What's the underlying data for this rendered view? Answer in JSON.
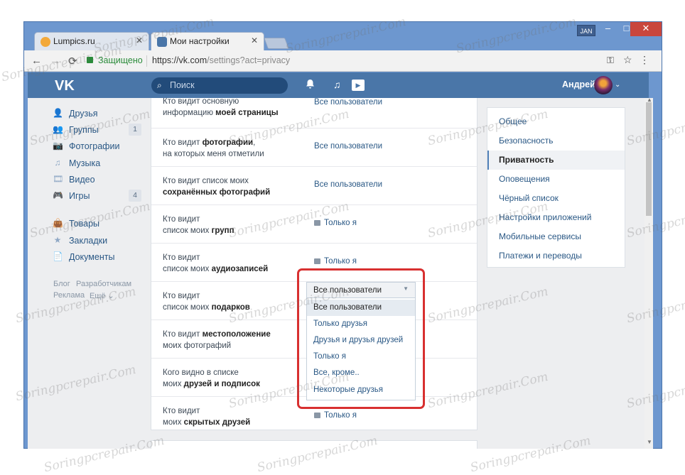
{
  "browser": {
    "tabs": [
      {
        "label": "Lumpics.ru",
        "favicon_color": "#f3a93a"
      },
      {
        "label": "Мои настройки",
        "favicon_color": "#4a76a8"
      }
    ],
    "profile_badge": "JAN",
    "window_controls": {
      "minimize": "–",
      "maximize": "□",
      "close": "✕"
    },
    "nav": {
      "back": "←",
      "forward": "→",
      "reload": "⟳"
    },
    "secure_label": "Защищено",
    "url_main": "https://vk.com",
    "url_rest": "/settings?act=privacy",
    "icons": {
      "key": "⚿",
      "star": "☆",
      "menu": "⋮"
    }
  },
  "header": {
    "logo": "VK",
    "search_placeholder": "Поиск",
    "user_name": "Андрей",
    "icons": {
      "search": "⌕",
      "bell": "🔔",
      "music": "♫",
      "play": "▶",
      "chevron": "⌄"
    }
  },
  "left_menu": {
    "items": [
      {
        "icon": "👤",
        "label": "Друзья",
        "count": ""
      },
      {
        "icon": "👥",
        "label": "Группы",
        "count": "1"
      },
      {
        "icon": "📷",
        "label": "Фотографии",
        "count": ""
      },
      {
        "icon": "♫",
        "label": "Музыка",
        "count": ""
      },
      {
        "icon": "🎞",
        "label": "Видео",
        "count": ""
      },
      {
        "icon": "🎮",
        "label": "Игры",
        "count": "4"
      },
      {
        "icon": "👜",
        "label": "Товары",
        "count": ""
      },
      {
        "icon": "★",
        "label": "Закладки",
        "count": ""
      },
      {
        "icon": "📄",
        "label": "Документы",
        "count": ""
      }
    ],
    "footer": {
      "blog": "Блог",
      "dev": "Разработчикам",
      "ads": "Реклама",
      "more": "Ещё ⌄"
    }
  },
  "privacy_rows": [
    {
      "line1": "Кто видит основную",
      "line2_prefix": "информацию ",
      "line2_bold": "моей страницы",
      "value": "Все пользователи",
      "locked": false
    },
    {
      "line1_prefix": "Кто видит ",
      "line1_bold": "фотографии",
      "line1_suffix": ",",
      "line2_prefix": "на которых меня отметили",
      "line2_bold": "",
      "value": "Все пользователи",
      "locked": false
    },
    {
      "line1": "Кто видит список моих",
      "line2_prefix": "",
      "line2_bold": "сохранённых фотографий",
      "value": "Все пользователи",
      "locked": false
    },
    {
      "line1": "Кто видит",
      "line2_prefix": "список моих ",
      "line2_bold": "групп",
      "value": "Только я",
      "locked": true
    },
    {
      "line1": "Кто видит",
      "line2_prefix": "список моих ",
      "line2_bold": "аудиозаписей",
      "value": "Только я",
      "locked": true
    },
    {
      "line1": "Кто видит",
      "line2_prefix": "список моих ",
      "line2_bold": "подарков",
      "value": "",
      "locked": false
    },
    {
      "line1_prefix": "Кто видит ",
      "line1_bold": "местоположение",
      "line1_suffix": "",
      "line2_prefix": "моих фотографий",
      "line2_bold": "",
      "value": "",
      "locked": false
    },
    {
      "line1": "Кого видно в списке",
      "line2_prefix": "моих ",
      "line2_bold": "друзей и подписок",
      "value": "",
      "locked": false
    },
    {
      "line1": "Кто видит",
      "line2_prefix": "моих ",
      "line2_bold": "скрытых друзей",
      "value": "Только я",
      "locked": true
    }
  ],
  "right_menu": {
    "items": [
      "Общее",
      "Безопасность",
      "Приватность",
      "Оповещения",
      "Чёрный список",
      "Настройки приложений",
      "Мобильные сервисы",
      "Платежи и переводы"
    ],
    "active": "Приватность"
  },
  "dropdown": {
    "selected": "Все пользователи",
    "options": [
      "Все пользователи",
      "Только друзья",
      "Друзья и друзья друзей",
      "Только я",
      "Все, кроме..",
      "Некоторые друзья"
    ],
    "arrow": "▼",
    "highlight_color": "#d83030"
  },
  "watermark": "Soringpcrepair.Com"
}
